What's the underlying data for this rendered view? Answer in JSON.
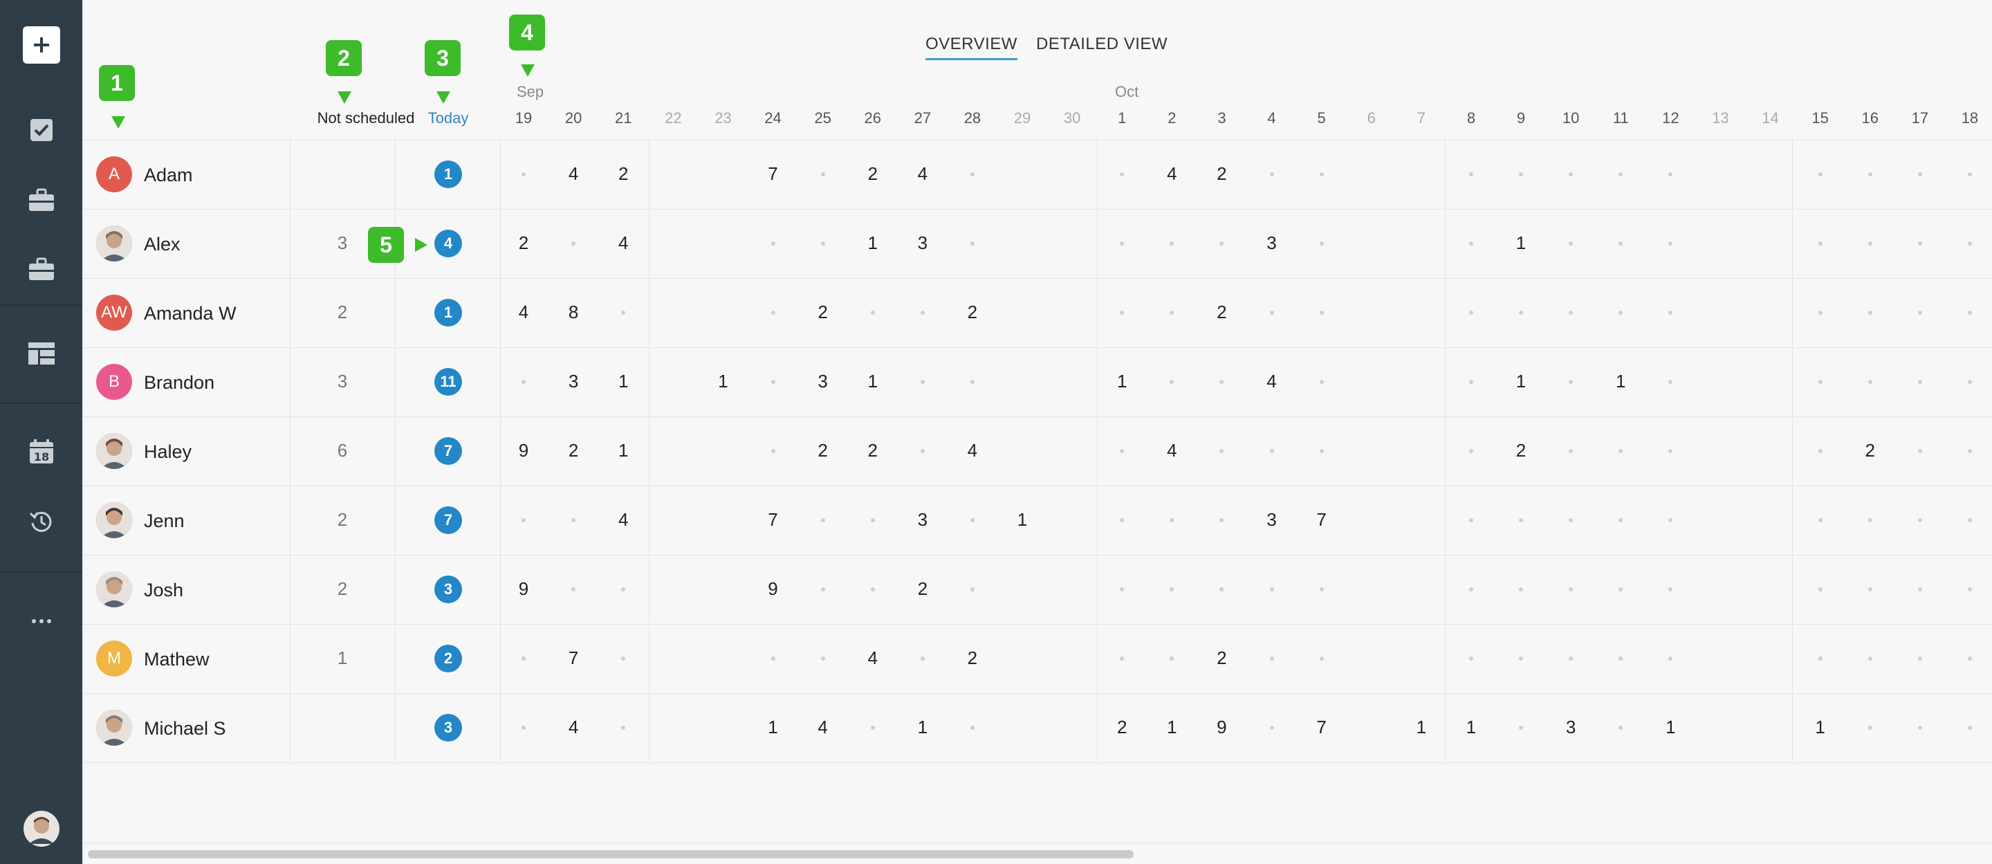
{
  "sidebar": {
    "items": [
      {
        "name": "add-button",
        "icon": "plus-icon"
      },
      {
        "name": "tasks-button",
        "icon": "checkbox-icon"
      },
      {
        "name": "projects-button",
        "icon": "briefcase-icon"
      },
      {
        "name": "clients-button",
        "icon": "briefcase-icon"
      },
      {
        "name": "dashboard-button",
        "icon": "dashboard-icon"
      },
      {
        "name": "calendar-button",
        "icon": "calendar-icon",
        "label": "18"
      },
      {
        "name": "history-button",
        "icon": "history-icon"
      },
      {
        "name": "more-button",
        "icon": "more-icon",
        "label": "..."
      }
    ]
  },
  "tabs": [
    {
      "label": "OVERVIEW",
      "active": true
    },
    {
      "label": "DETAILED VIEW",
      "active": false
    }
  ],
  "header": {
    "not_scheduled": "Not scheduled",
    "today": "Today",
    "months": [
      "Sep",
      "Oct"
    ]
  },
  "days": [
    "19",
    "20",
    "21",
    "22",
    "23",
    "24",
    "25",
    "26",
    "27",
    "28",
    "29",
    "30",
    "1",
    "2",
    "3",
    "4",
    "5",
    "6",
    "7",
    "8",
    "9",
    "10",
    "11",
    "12",
    "13",
    "14",
    "15",
    "16",
    "17",
    "18"
  ],
  "weekend_indices": [
    3,
    4,
    10,
    11,
    17,
    18,
    24,
    25
  ],
  "markers": [
    "1",
    "2",
    "3",
    "4",
    "5"
  ],
  "people": [
    {
      "name": "Adam",
      "initials": "A",
      "color": "#e05a4f",
      "not_scheduled": "",
      "today": "1",
      "cells": [
        "•",
        "4",
        "2",
        "",
        "",
        "7",
        "•",
        "2",
        "4",
        "•",
        "",
        "",
        "•",
        "4",
        "2",
        "•",
        "•",
        "",
        "",
        "•",
        "•",
        "•",
        "•",
        "•",
        "",
        "",
        "•",
        "•",
        "•",
        "•"
      ]
    },
    {
      "name": "Alex",
      "initials": "",
      "color": "#8a6d55",
      "not_scheduled": "3",
      "today": "4",
      "cells": [
        "2",
        "•",
        "4",
        "",
        "",
        "•",
        "•",
        "1",
        "3",
        "•",
        "",
        "",
        "•",
        "•",
        "•",
        "3",
        "•",
        "",
        "",
        "•",
        "1",
        "•",
        "•",
        "•",
        "",
        "",
        "•",
        "•",
        "•",
        "•"
      ]
    },
    {
      "name": "Amanda W",
      "initials": "AW",
      "color": "#e05a4f",
      "not_scheduled": "2",
      "today": "1",
      "cells": [
        "4",
        "8",
        "•",
        "",
        "",
        "•",
        "2",
        "•",
        "•",
        "2",
        "",
        "",
        "•",
        "•",
        "2",
        "•",
        "•",
        "",
        "",
        "•",
        "•",
        "•",
        "•",
        "•",
        "",
        "",
        "•",
        "•",
        "•",
        "•"
      ]
    },
    {
      "name": "Brandon",
      "initials": "B",
      "color": "#e9588f",
      "not_scheduled": "3",
      "today": "11",
      "cells": [
        "•",
        "3",
        "1",
        "",
        "1",
        "•",
        "3",
        "1",
        "•",
        "•",
        "",
        "",
        "1",
        "•",
        "•",
        "4",
        "•",
        "",
        "",
        "•",
        "1",
        "•",
        "1",
        "•",
        "",
        "",
        "•",
        "•",
        "•",
        "•"
      ]
    },
    {
      "name": "Haley",
      "initials": "",
      "color": "#7a4a3a",
      "not_scheduled": "6",
      "today": "7",
      "cells": [
        "9",
        "2",
        "1",
        "",
        "",
        "•",
        "2",
        "2",
        "•",
        "4",
        "",
        "",
        "•",
        "4",
        "•",
        "•",
        "•",
        "",
        "",
        "•",
        "2",
        "•",
        "•",
        "•",
        "",
        "",
        "•",
        "2",
        "•",
        "•"
      ]
    },
    {
      "name": "Jenn",
      "initials": "",
      "color": "#4a3630",
      "not_scheduled": "2",
      "today": "7",
      "cells": [
        "•",
        "•",
        "4",
        "",
        "",
        "7",
        "•",
        "•",
        "3",
        "•",
        "1",
        "",
        "•",
        "•",
        "•",
        "3",
        "7",
        "",
        "",
        "•",
        "•",
        "•",
        "•",
        "•",
        "",
        "",
        "•",
        "•",
        "•",
        "•"
      ]
    },
    {
      "name": "Josh",
      "initials": "",
      "color": "#9a8a80",
      "not_scheduled": "2",
      "today": "3",
      "cells": [
        "9",
        "•",
        "•",
        "",
        "",
        "9",
        "•",
        "•",
        "2",
        "•",
        "",
        "",
        "•",
        "•",
        "•",
        "•",
        "•",
        "",
        "",
        "•",
        "•",
        "•",
        "•",
        "•",
        "",
        "",
        "•",
        "•",
        "•",
        "•"
      ]
    },
    {
      "name": "Mathew",
      "initials": "M",
      "color": "#f0b544",
      "not_scheduled": "1",
      "today": "2",
      "cells": [
        "•",
        "7",
        "•",
        "",
        "",
        "•",
        "•",
        "4",
        "•",
        "2",
        "",
        "",
        "•",
        "•",
        "2",
        "•",
        "•",
        "",
        "",
        "•",
        "•",
        "•",
        "•",
        "•",
        "",
        "",
        "•",
        "•",
        "•",
        "•"
      ]
    },
    {
      "name": "Michael S",
      "initials": "",
      "color": "#8c7b70",
      "not_scheduled": "",
      "today": "3",
      "cells": [
        "•",
        "4",
        "•",
        "",
        "",
        "1",
        "4",
        "•",
        "1",
        "•",
        "",
        "",
        "2",
        "1",
        "9",
        "•",
        "7",
        "",
        "1",
        "1",
        "•",
        "3",
        "•",
        "1",
        "",
        "",
        "1",
        "•",
        "•",
        "•"
      ]
    }
  ],
  "colors": {
    "accent": "#2387c8",
    "marker": "#3dbb2a",
    "sidebar": "#2e3d47"
  }
}
